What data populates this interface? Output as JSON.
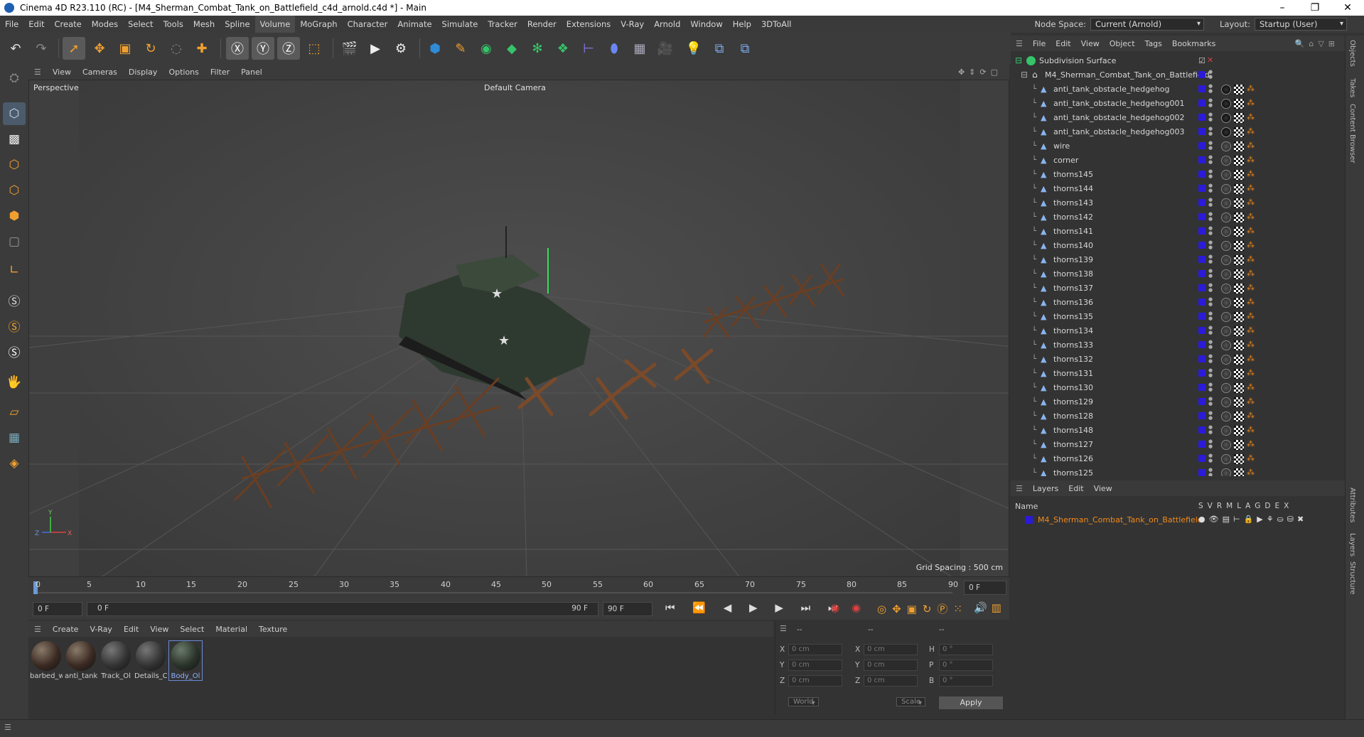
{
  "window": {
    "title": "Cinema 4D R23.110 (RC) - [M4_Sherman_Combat_Tank_on_Battlefield_c4d_arnold.c4d *] - Main"
  },
  "menubar": {
    "items": [
      "File",
      "Edit",
      "Create",
      "Modes",
      "Select",
      "Tools",
      "Mesh",
      "Spline",
      "Volume",
      "MoGraph",
      "Character",
      "Animate",
      "Simulate",
      "Tracker",
      "Render",
      "Extensions",
      "V-Ray",
      "Arnold",
      "Window",
      "Help",
      "3DToAll"
    ],
    "active": "Volume",
    "node_space_label": "Node Space:",
    "node_space_value": "Current (Arnold)",
    "layout_label": "Layout:",
    "layout_value": "Startup (User)"
  },
  "viewport": {
    "menu": [
      "View",
      "Cameras",
      "Display",
      "Options",
      "Filter",
      "Panel"
    ],
    "perspective_label": "Perspective",
    "camera_label": "Default Camera",
    "grid_spacing": "Grid Spacing : 500 cm"
  },
  "timeline": {
    "ticks": [
      "0",
      "5",
      "10",
      "15",
      "20",
      "25",
      "30",
      "35",
      "40",
      "45",
      "50",
      "55",
      "60",
      "65",
      "70",
      "75",
      "80",
      "85",
      "90"
    ],
    "current_frame_right": "0 F",
    "start_field": "0 F",
    "range_start": "0 F",
    "range_end": "90 F",
    "end_field": "90 F"
  },
  "materials": {
    "menu": [
      "Create",
      "V-Ray",
      "Edit",
      "View",
      "Select",
      "Material",
      "Texture"
    ],
    "items": [
      {
        "label": "barbed_w"
      },
      {
        "label": "anti_tank"
      },
      {
        "label": "Track_Ol"
      },
      {
        "label": "Details_C"
      },
      {
        "label": "Body_Ol"
      }
    ]
  },
  "coordinates": {
    "headers": [
      "--",
      "--",
      "--"
    ],
    "rows": [
      {
        "a": "X",
        "av": "0 cm",
        "b": "X",
        "bv": "0 cm",
        "c": "H",
        "cv": "0 °"
      },
      {
        "a": "Y",
        "av": "0 cm",
        "b": "Y",
        "bv": "0 cm",
        "c": "P",
        "cv": "0 °"
      },
      {
        "a": "Z",
        "av": "0 cm",
        "b": "Z",
        "bv": "0 cm",
        "c": "B",
        "cv": "0 °"
      }
    ],
    "mode1": "World",
    "mode2": "Scale",
    "apply": "Apply"
  },
  "object_manager": {
    "menu": [
      "File",
      "Edit",
      "View",
      "Object",
      "Tags",
      "Bookmarks"
    ],
    "root": "Subdivision Surface",
    "group": "M4_Sherman_Combat_Tank_on_Battlefield",
    "children": [
      "anti_tank_obstacle_hedgehog",
      "anti_tank_obstacle_hedgehog001",
      "anti_tank_obstacle_hedgehog002",
      "anti_tank_obstacle_hedgehog003",
      "wire",
      "corner",
      "thorns145",
      "thorns144",
      "thorns143",
      "thorns142",
      "thorns141",
      "thorns140",
      "thorns139",
      "thorns138",
      "thorns137",
      "thorns136",
      "thorns135",
      "thorns134",
      "thorns133",
      "thorns132",
      "thorns131",
      "thorns130",
      "thorns129",
      "thorns128",
      "thorns148",
      "thorns127",
      "thorns126",
      "thorns125"
    ]
  },
  "layers": {
    "menu": [
      "Layers",
      "Edit",
      "View"
    ],
    "name_header": "Name",
    "col_headers": [
      "S",
      "V",
      "R",
      "M",
      "L",
      "A",
      "G",
      "D",
      "E",
      "X"
    ],
    "layer_name": "M4_Sherman_Combat_Tank_on_Battlefield",
    "layer_color": "#2b1bd8"
  },
  "side_tabs": [
    "Objects",
    "Takes",
    "Content Browser",
    "Attributes",
    "Layers",
    "Structure"
  ],
  "colors": {
    "accent": "#f08a1c",
    "swatch": "#2b1bd8",
    "toolbar_blue": "#2f8bd6"
  }
}
